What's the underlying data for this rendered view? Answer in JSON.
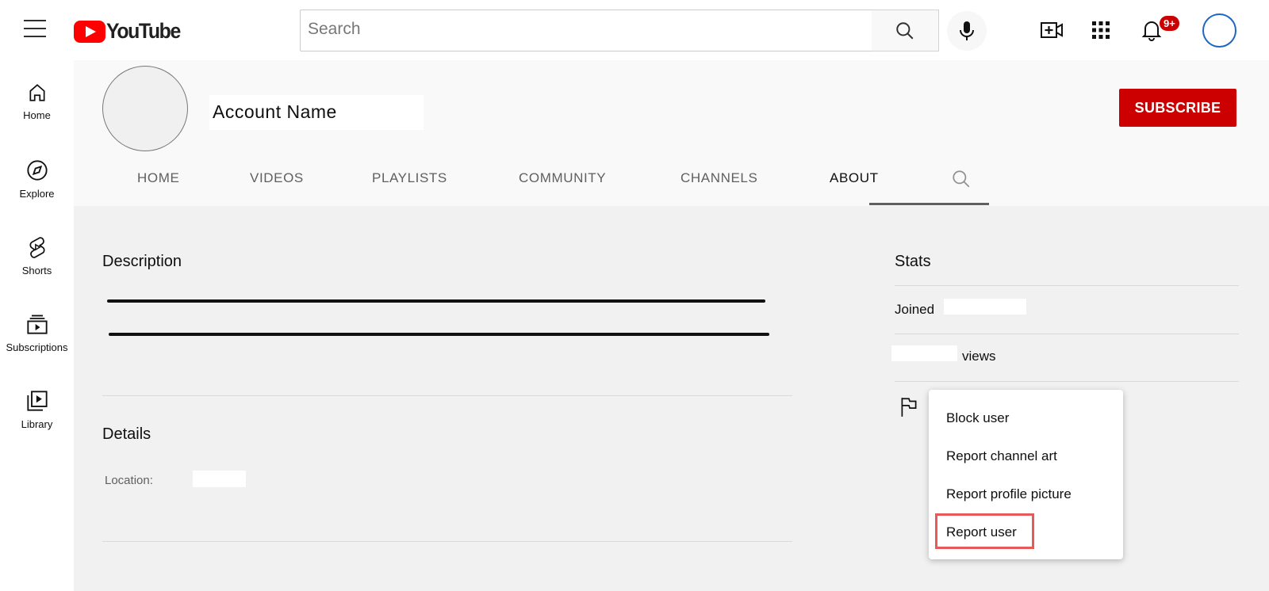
{
  "header": {
    "logo_text": "YouTube",
    "search_placeholder": "Search",
    "notification_count": "9+"
  },
  "sidebar": {
    "items": [
      {
        "label": "Home",
        "icon": "home-icon"
      },
      {
        "label": "Explore",
        "icon": "compass-icon"
      },
      {
        "label": "Shorts",
        "icon": "shorts-icon"
      },
      {
        "label": "Subscriptions",
        "icon": "subscriptions-icon"
      },
      {
        "label": "Library",
        "icon": "library-icon"
      }
    ]
  },
  "channel": {
    "name": "Account Name",
    "subscribe_label": "SUBSCRIBE",
    "tabs": [
      {
        "label": "HOME"
      },
      {
        "label": "VIDEOS"
      },
      {
        "label": "PLAYLISTS"
      },
      {
        "label": "COMMUNITY"
      },
      {
        "label": "CHANNELS"
      },
      {
        "label": "ABOUT"
      }
    ],
    "active_tab": "ABOUT"
  },
  "about": {
    "description_heading": "Description",
    "details_heading": "Details",
    "location_label": "Location:",
    "stats_heading": "Stats",
    "joined_label": "Joined",
    "views_label": "views"
  },
  "menu": {
    "items": [
      {
        "label": "Block user"
      },
      {
        "label": "Report channel art"
      },
      {
        "label": "Report profile picture"
      },
      {
        "label": "Report user"
      }
    ],
    "highlighted": "Report user"
  },
  "colors": {
    "brand_red": "#ff0000",
    "subscribe_red": "#cc0000",
    "highlight_border": "#e85a5a"
  }
}
